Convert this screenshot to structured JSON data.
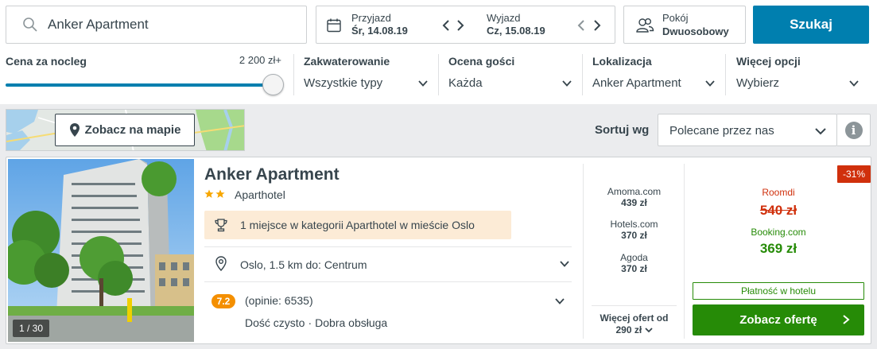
{
  "search": {
    "value": "Anker Apartment",
    "checkin_label": "Przyjazd",
    "checkin_value": "Śr, 14.08.19",
    "checkout_label": "Wyjazd",
    "checkout_value": "Cz, 15.08.19",
    "room_label": "Pokój",
    "room_value": "Dwuosobowy",
    "submit_label": "Szukaj"
  },
  "filters": {
    "price": {
      "title": "Cena za nocleg",
      "max": "2 200 zł+",
      "level_percent": 100
    },
    "accommodation": {
      "title": "Zakwaterowanie",
      "value": "Wszystkie typy"
    },
    "rating": {
      "title": "Ocena gości",
      "value": "Każda"
    },
    "location": {
      "title": "Lokalizacja",
      "value": "Anker Apartment"
    },
    "more": {
      "title": "Więcej opcji",
      "value": "Wybierz"
    }
  },
  "toolbar": {
    "map_button": "Zobacz na mapie",
    "sort_label": "Sortuj wg",
    "sort_value": "Polecane przez nas"
  },
  "result": {
    "photo_counter": "1 / 30",
    "name": "Anker Apartment",
    "star_count": 2,
    "type": "Aparthotel",
    "award": "1 miejsce w kategorii Aparthotel w mieście Oslo",
    "location": "Oslo, 1.5 km do: Centrum",
    "rating_score": "7.2",
    "rating_count": "(opinie: 6535)",
    "rating_notes": [
      "Dość czysto",
      "Dobra obsługa"
    ],
    "offers": [
      {
        "site": "Amoma.com",
        "price": "439 zł"
      },
      {
        "site": "Hotels.com",
        "price": "370 zł"
      },
      {
        "site": "Agoda",
        "price": "370 zł"
      }
    ],
    "more_offers_label": "Więcej ofert od",
    "more_offers_price": "290 zł",
    "discount": "-31%",
    "old_site": "Roomdi",
    "old_price": "540 zł",
    "best_site": "Booking.com",
    "best_price": "369 zł",
    "pay_at_hotel": "Płatność w hotelu",
    "cta": "Zobacz ofertę"
  },
  "colors": {
    "accent_blue": "#007faf",
    "deal_green": "#268b07",
    "discount_red": "#d0300c",
    "rating_orange": "#f48f00",
    "star_gold": "#f7a600"
  }
}
